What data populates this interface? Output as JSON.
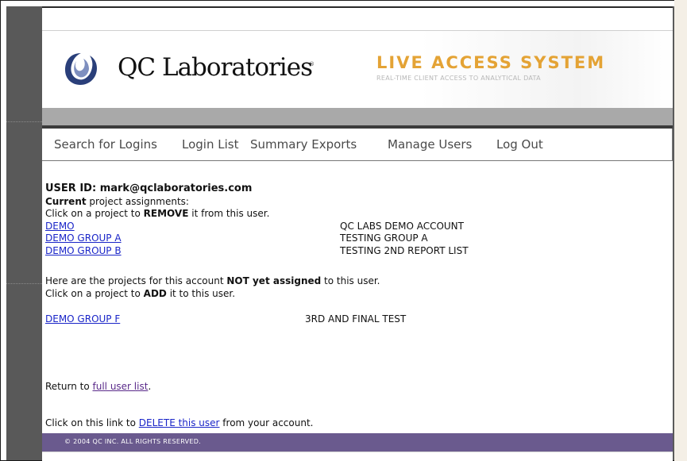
{
  "header": {
    "logo_text": "QC Laboratories",
    "logo_mark": "®",
    "system_title": "LIVE ACCESS SYSTEM",
    "system_subtitle": "REAL-TIME CLIENT ACCESS TO ANALYTICAL DATA"
  },
  "nav": {
    "items": [
      {
        "label": "Search for Logins"
      },
      {
        "label": "Login List"
      },
      {
        "label": "Summary Exports"
      },
      {
        "label": "Manage Users"
      },
      {
        "label": "Log Out"
      }
    ]
  },
  "user": {
    "id_label": "USER ID: mark@qclaboratories.com",
    "current_bold": "Current",
    "current_rest": " project assignments:",
    "remove_pre": "Click on a project to ",
    "remove_bold": "REMOVE",
    "remove_post": " it from this user."
  },
  "assigned": [
    {
      "name": "DEMO",
      "description": "QC LABS DEMO ACCOUNT"
    },
    {
      "name": "DEMO GROUP A",
      "description": "TESTING GROUP A"
    },
    {
      "name": "DEMO GROUP B",
      "description": "TESTING 2ND REPORT LIST"
    }
  ],
  "unassigned_intro": {
    "pre": "Here are the projects for this account ",
    "bold": "NOT yet assigned",
    "post": " to this user.",
    "add_pre": "Click on a project to ",
    "add_bold": "ADD",
    "add_post": " it to this user."
  },
  "unassigned": [
    {
      "name": "DEMO GROUP F",
      "description": "3RD AND FINAL TEST"
    }
  ],
  "return": {
    "pre": "Return to ",
    "link": "full user list",
    "post": "."
  },
  "delete": {
    "pre": "Click on this link to ",
    "link": "DELETE this user",
    "post": " from your account."
  },
  "footer": {
    "copyright": "© 2004 QC INC.  ALL RIGHTS RESERVED."
  },
  "colors": {
    "accent": "#e4a335",
    "footer_bg": "#6a5a8e",
    "link": "#1a25c8"
  }
}
